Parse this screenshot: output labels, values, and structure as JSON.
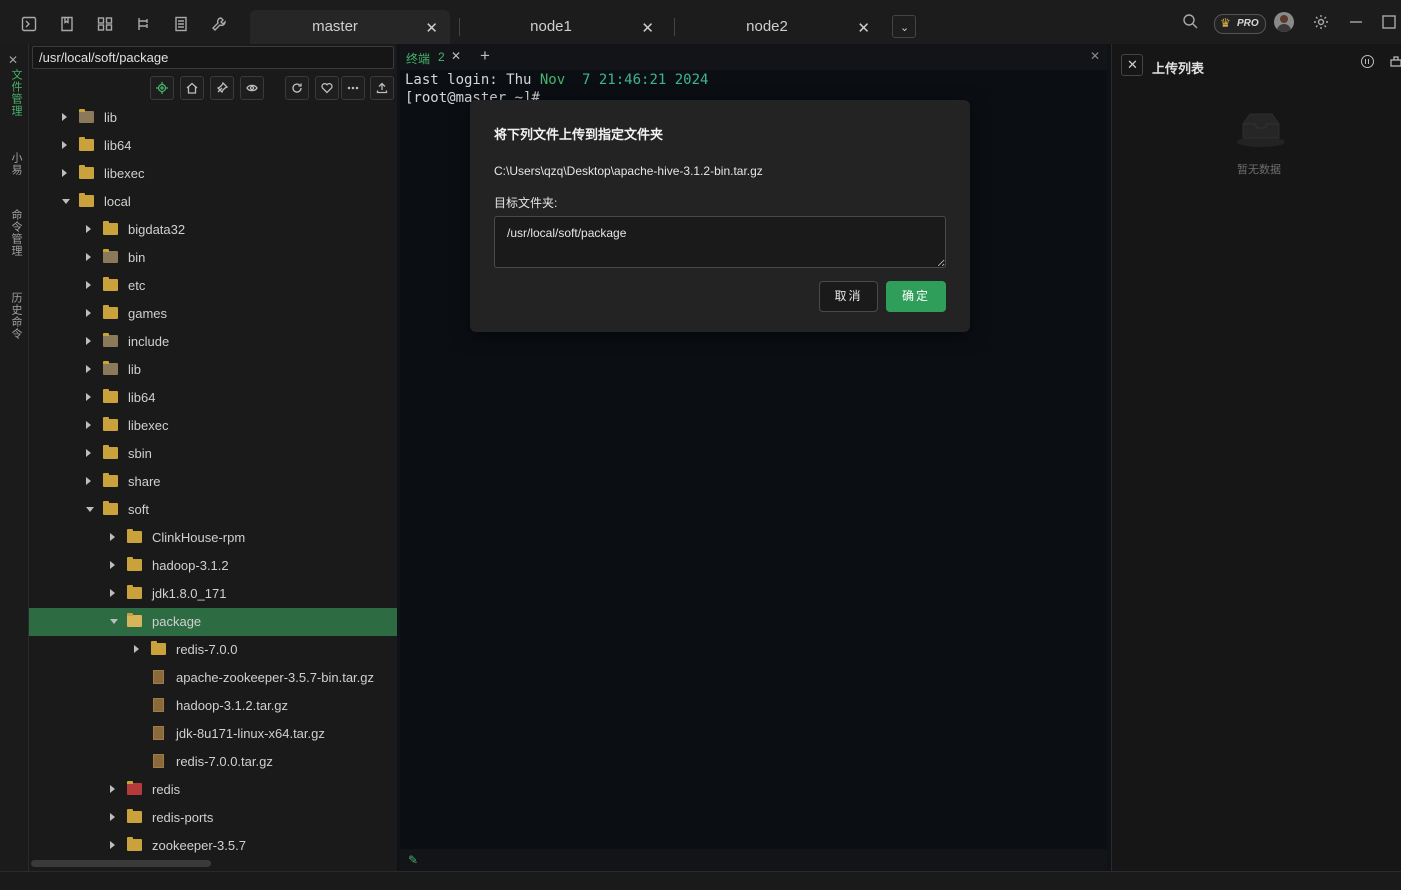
{
  "titlebar": {
    "tabs": [
      {
        "label": "master",
        "active": true
      },
      {
        "label": "node1",
        "active": false
      },
      {
        "label": "node2",
        "active": false
      }
    ],
    "pro_badge": "PRO"
  },
  "rail": {
    "items": [
      "文件管理",
      "小易",
      "命令管理",
      "历史命令"
    ]
  },
  "file_panel": {
    "path": "/usr/local/soft/package",
    "tree": [
      {
        "name": "lib",
        "depth": 0,
        "expand": "right",
        "type": "folder-special"
      },
      {
        "name": "lib64",
        "depth": 0,
        "expand": "right",
        "type": "folder"
      },
      {
        "name": "libexec",
        "depth": 0,
        "expand": "right",
        "type": "folder"
      },
      {
        "name": "local",
        "depth": 0,
        "expand": "down",
        "type": "folder"
      },
      {
        "name": "bigdata32",
        "depth": 1,
        "expand": "right",
        "type": "folder"
      },
      {
        "name": "bin",
        "depth": 1,
        "expand": "right",
        "type": "folder-special"
      },
      {
        "name": "etc",
        "depth": 1,
        "expand": "right",
        "type": "folder"
      },
      {
        "name": "games",
        "depth": 1,
        "expand": "right",
        "type": "folder"
      },
      {
        "name": "include",
        "depth": 1,
        "expand": "right",
        "type": "folder-special"
      },
      {
        "name": "lib",
        "depth": 1,
        "expand": "right",
        "type": "folder-special"
      },
      {
        "name": "lib64",
        "depth": 1,
        "expand": "right",
        "type": "folder"
      },
      {
        "name": "libexec",
        "depth": 1,
        "expand": "right",
        "type": "folder"
      },
      {
        "name": "sbin",
        "depth": 1,
        "expand": "right",
        "type": "folder"
      },
      {
        "name": "share",
        "depth": 1,
        "expand": "right",
        "type": "folder"
      },
      {
        "name": "soft",
        "depth": 1,
        "expand": "down",
        "type": "folder"
      },
      {
        "name": "ClinkHouse-rpm",
        "depth": 2,
        "expand": "right",
        "type": "folder"
      },
      {
        "name": "hadoop-3.1.2",
        "depth": 2,
        "expand": "right",
        "type": "folder"
      },
      {
        "name": "jdk1.8.0_171",
        "depth": 2,
        "expand": "right",
        "type": "folder"
      },
      {
        "name": "package",
        "depth": 2,
        "expand": "down",
        "type": "folder",
        "selected": true
      },
      {
        "name": "redis-7.0.0",
        "depth": 3,
        "expand": "right",
        "type": "folder"
      },
      {
        "name": "apache-zookeeper-3.5.7-bin.tar.gz",
        "depth": 3,
        "expand": "none",
        "type": "file"
      },
      {
        "name": "hadoop-3.1.2.tar.gz",
        "depth": 3,
        "expand": "none",
        "type": "file"
      },
      {
        "name": "jdk-8u171-linux-x64.tar.gz",
        "depth": 3,
        "expand": "none",
        "type": "file"
      },
      {
        "name": "redis-7.0.0.tar.gz",
        "depth": 3,
        "expand": "none",
        "type": "file"
      },
      {
        "name": "redis",
        "depth": 2,
        "expand": "right",
        "type": "folder-red"
      },
      {
        "name": "redis-ports",
        "depth": 2,
        "expand": "right",
        "type": "folder"
      },
      {
        "name": "zookeeper-3.5.7",
        "depth": 2,
        "expand": "right",
        "type": "folder"
      }
    ]
  },
  "terminal": {
    "tab_label": "终端",
    "tab_number": "2",
    "add_symbol": "+",
    "line1_prefix": "Last login: Thu ",
    "line1_month": "Nov",
    "line1_rest": "  7 21:46:21 2024",
    "line2": "[root@master ~]#"
  },
  "upload_panel": {
    "title": "上传列表",
    "empty_text": "暂无数据"
  },
  "modal": {
    "title": "将下列文件上传到指定文件夹",
    "file_path": "C:\\Users\\qzq\\Desktop\\apache-hive-3.1.2-bin.tar.gz",
    "target_label": "目标文件夹:",
    "target_value": "/usr/local/soft/package",
    "cancel_label": "取消",
    "ok_label": "确定"
  },
  "colors": {
    "accent_green": "#2f9e5b",
    "selected_row": "#2d6b43",
    "folder": "#c9a23c"
  }
}
